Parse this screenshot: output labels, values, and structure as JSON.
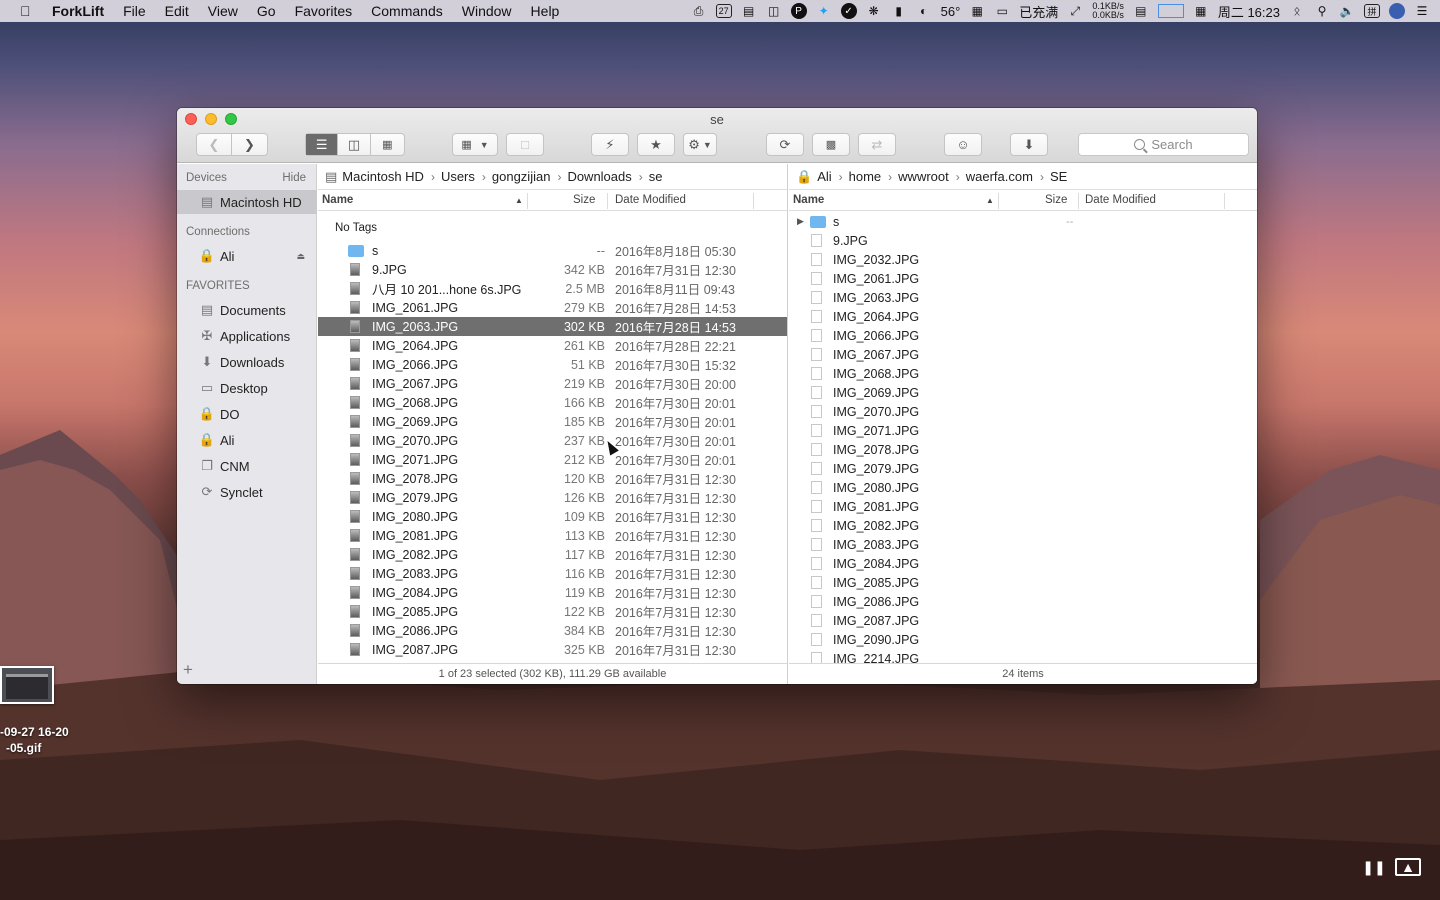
{
  "menubar": {
    "app": "ForkLift",
    "items": [
      "File",
      "Edit",
      "View",
      "Go",
      "Favorites",
      "Commands",
      "Window",
      "Help"
    ],
    "status": {
      "calendar_day": "27",
      "temperature": "56°",
      "battery_text": "已充满",
      "net_up": "0.1KB/s",
      "net_down": "0.0KB/s",
      "clock": "周二 16:23",
      "input_method": "拼"
    }
  },
  "window": {
    "title": "se",
    "search_placeholder": "Search"
  },
  "sidebar": {
    "devices_label": "Devices",
    "hide_label": "Hide",
    "connections_label": "Connections",
    "favorites_label": "FAVORITES",
    "devices": [
      {
        "label": "Macintosh HD",
        "icon": "hard-drive-icon"
      }
    ],
    "connections": [
      {
        "label": "Ali",
        "icon": "lock-icon"
      }
    ],
    "favorites": [
      {
        "label": "Documents",
        "icon": "documents-icon"
      },
      {
        "label": "Applications",
        "icon": "applications-icon"
      },
      {
        "label": "Downloads",
        "icon": "downloads-icon"
      },
      {
        "label": "Desktop",
        "icon": "desktop-icon"
      },
      {
        "label": "DO",
        "icon": "lock-icon"
      },
      {
        "label": "Ali",
        "icon": "lock-icon"
      },
      {
        "label": "CNM",
        "icon": "cnm-icon"
      },
      {
        "label": "Synclet",
        "icon": "sync-icon"
      }
    ],
    "add_label": "+"
  },
  "left_pane": {
    "path": [
      "Macintosh HD",
      "Users",
      "gongzijian",
      "Downloads",
      "se"
    ],
    "col_name": "Name",
    "col_size": "Size",
    "col_date": "Date Modified",
    "tags_label": "No Tags",
    "rows": [
      {
        "name": "s",
        "size": "--",
        "date": "2016年8月18日 05:30",
        "folder": true
      },
      {
        "name": "9.JPG",
        "size": "342 KB",
        "date": "2016年7月31日 12:30"
      },
      {
        "name": "八月 10 201...hone 6s.JPG",
        "size": "2.5 MB",
        "date": "2016年8月11日 09:43"
      },
      {
        "name": "IMG_2061.JPG",
        "size": "279 KB",
        "date": "2016年7月28日 14:53"
      },
      {
        "name": "IMG_2063.JPG",
        "size": "302 KB",
        "date": "2016年7月28日 14:53",
        "selected": true
      },
      {
        "name": "IMG_2064.JPG",
        "size": "261 KB",
        "date": "2016年7月28日 22:21"
      },
      {
        "name": "IMG_2066.JPG",
        "size": "51 KB",
        "date": "2016年7月30日 15:32"
      },
      {
        "name": "IMG_2067.JPG",
        "size": "219 KB",
        "date": "2016年7月30日 20:00"
      },
      {
        "name": "IMG_2068.JPG",
        "size": "166 KB",
        "date": "2016年7月30日 20:01"
      },
      {
        "name": "IMG_2069.JPG",
        "size": "185 KB",
        "date": "2016年7月30日 20:01"
      },
      {
        "name": "IMG_2070.JPG",
        "size": "237 KB",
        "date": "2016年7月30日 20:01"
      },
      {
        "name": "IMG_2071.JPG",
        "size": "212 KB",
        "date": "2016年7月30日 20:01"
      },
      {
        "name": "IMG_2078.JPG",
        "size": "120 KB",
        "date": "2016年7月31日 12:30"
      },
      {
        "name": "IMG_2079.JPG",
        "size": "126 KB",
        "date": "2016年7月31日 12:30"
      },
      {
        "name": "IMG_2080.JPG",
        "size": "109 KB",
        "date": "2016年7月31日 12:30"
      },
      {
        "name": "IMG_2081.JPG",
        "size": "113 KB",
        "date": "2016年7月31日 12:30"
      },
      {
        "name": "IMG_2082.JPG",
        "size": "117 KB",
        "date": "2016年7月31日 12:30"
      },
      {
        "name": "IMG_2083.JPG",
        "size": "116 KB",
        "date": "2016年7月31日 12:30"
      },
      {
        "name": "IMG_2084.JPG",
        "size": "119 KB",
        "date": "2016年7月31日 12:30"
      },
      {
        "name": "IMG_2085.JPG",
        "size": "122 KB",
        "date": "2016年7月31日 12:30"
      },
      {
        "name": "IMG_2086.JPG",
        "size": "384 KB",
        "date": "2016年7月31日 12:30"
      },
      {
        "name": "IMG_2087.JPG",
        "size": "325 KB",
        "date": "2016年7月31日 12:30"
      }
    ],
    "status": "1 of 23 selected (302 KB), 111.29 GB available"
  },
  "right_pane": {
    "path": [
      "Ali",
      "home",
      "wwwroot",
      "waerfa.com",
      "SE"
    ],
    "col_name": "Name",
    "col_size": "Size",
    "col_date": "Date Modified",
    "folder_size": "--",
    "rows": [
      {
        "name": "s",
        "folder": true
      },
      {
        "name": "9.JPG"
      },
      {
        "name": "IMG_2032.JPG"
      },
      {
        "name": "IMG_2061.JPG"
      },
      {
        "name": "IMG_2063.JPG"
      },
      {
        "name": "IMG_2064.JPG"
      },
      {
        "name": "IMG_2066.JPG"
      },
      {
        "name": "IMG_2067.JPG"
      },
      {
        "name": "IMG_2068.JPG"
      },
      {
        "name": "IMG_2069.JPG"
      },
      {
        "name": "IMG_2070.JPG"
      },
      {
        "name": "IMG_2071.JPG"
      },
      {
        "name": "IMG_2078.JPG"
      },
      {
        "name": "IMG_2079.JPG"
      },
      {
        "name": "IMG_2080.JPG"
      },
      {
        "name": "IMG_2081.JPG"
      },
      {
        "name": "IMG_2082.JPG"
      },
      {
        "name": "IMG_2083.JPG"
      },
      {
        "name": "IMG_2084.JPG"
      },
      {
        "name": "IMG_2085.JPG"
      },
      {
        "name": "IMG_2086.JPG"
      },
      {
        "name": "IMG_2087.JPG"
      },
      {
        "name": "IMG_2090.JPG"
      },
      {
        "name": "IMG_2214.JPG"
      }
    ],
    "status": "24 items"
  },
  "desktop": {
    "file_label_line1": "-09-27 16-20",
    "file_label_line2": "-05.gif"
  },
  "colors": {
    "selection": "#6f6f6f",
    "folder": "#6fb7ee",
    "sidebar_bg": "#e7e6ea"
  }
}
